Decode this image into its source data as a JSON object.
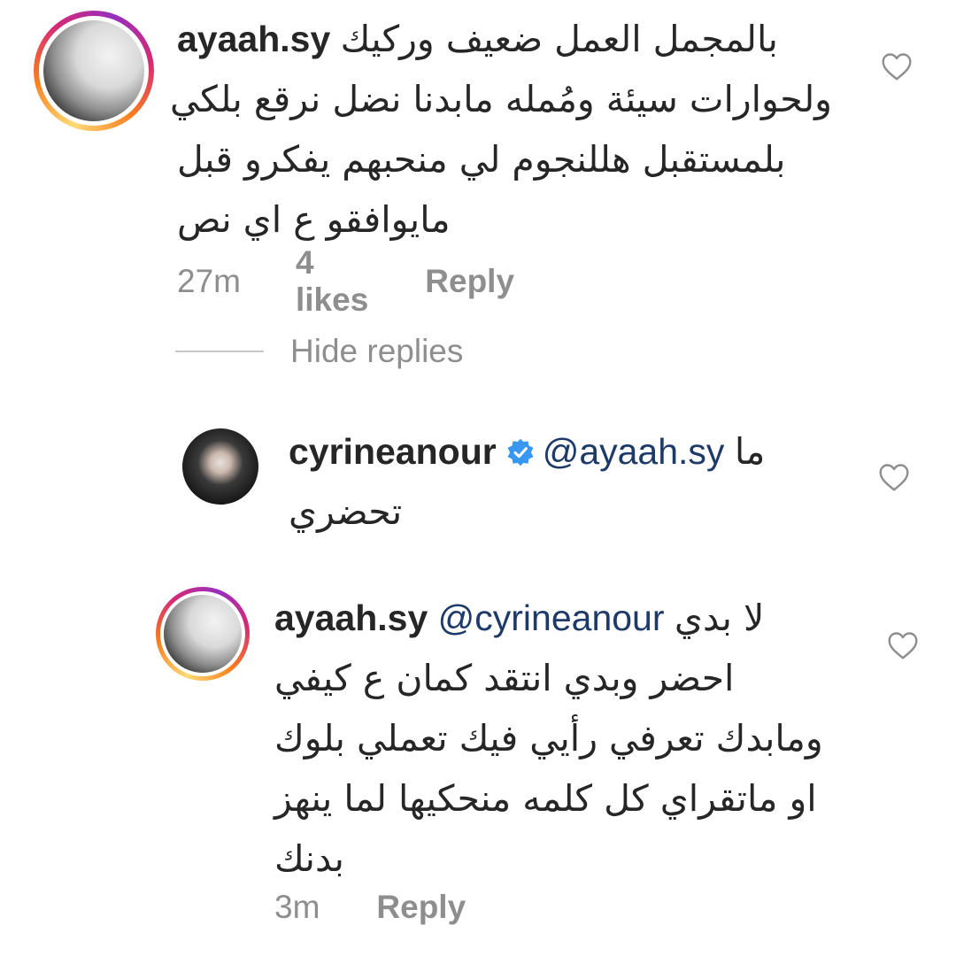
{
  "comments": [
    {
      "username": "ayaah.sy",
      "lines": [
        "بالمجمل العمل ضعيف وركيك",
        "ولحوارات سيئة ومُمله مابدنا نضل نرقع بلكي",
        "بلمستقبل هللنجوم لي منحبهم يفكرو قبل",
        "مايوافقو ع اي نص"
      ],
      "time": "27m",
      "likes": "4 likes",
      "reply_label": "Reply"
    }
  ],
  "hide_replies_label": "Hide replies",
  "replies": [
    {
      "username": "cyrineanour",
      "verified": true,
      "mention": "@ayaah.sy",
      "first_text": "ما",
      "lines": [
        "تحضري"
      ]
    },
    {
      "username": "ayaah.sy",
      "mention": "@cyrineanour",
      "first_text": "لا بدي",
      "lines": [
        "احضر وبدي انتقد كمان ع كيفي",
        "ومابدك تعرفي رأيي فيك تعملي بلوك",
        "او ماتقراي كل كلمه منحكيها لما ينهز",
        "بدنك"
      ],
      "time": "3m",
      "reply_label": "Reply"
    }
  ],
  "icons": {
    "like": "heart-outline-icon",
    "verified": "verified-badge-icon"
  },
  "colors": {
    "mention": "#1e3a68",
    "meta": "#8e8e8e",
    "verified": "#3897f0"
  }
}
